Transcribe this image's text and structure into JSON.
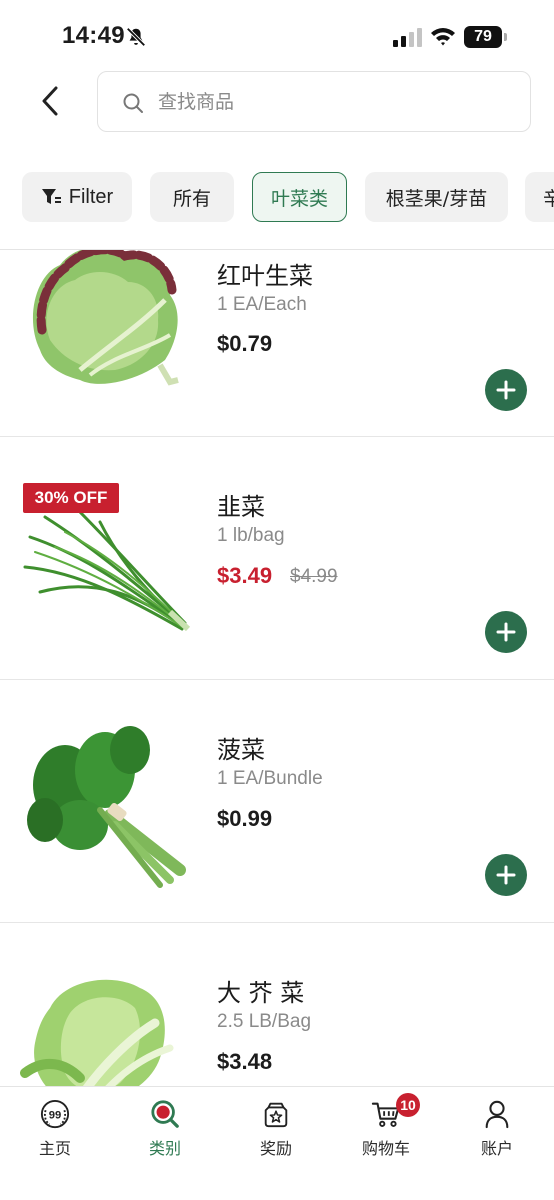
{
  "status_bar": {
    "time": "14:49",
    "battery": "79",
    "icons": [
      "bell-slash-icon",
      "signal-icon",
      "wifi-icon",
      "battery-icon"
    ]
  },
  "header": {
    "back_icon": "chevron-left-icon",
    "search": {
      "placeholder": "查找商品",
      "value": "",
      "icon": "search-icon"
    }
  },
  "chips": {
    "filter": "Filter",
    "all": "所有",
    "leafy": "叶菜类",
    "root": "根茎果/芽苗",
    "more": "辛"
  },
  "active_chip": "叶菜类",
  "products": [
    {
      "name": "红叶生菜",
      "unit": "1 EA/Each",
      "price": "$0.79",
      "image": "red-leaf-lettuce"
    },
    {
      "name": "韭菜",
      "unit": "1 lb/bag",
      "price": "$3.49",
      "old_price": "$4.99",
      "badge": "30% OFF",
      "image": "chives"
    },
    {
      "name": "菠菜",
      "unit": "1 EA/Bundle",
      "price": "$0.99",
      "image": "spinach"
    },
    {
      "name": "大 芥 菜",
      "unit": "2.5 LB/Bag",
      "price": "$3.48",
      "image": "mustard-greens"
    }
  ],
  "bottom_nav": {
    "home": "主页",
    "category": "类别",
    "rewards": "奖励",
    "cart": "购物车",
    "account": "账户",
    "cart_count": "10",
    "home_logo_text": "99",
    "active": "类别"
  },
  "colors": {
    "brand_green": "#2c6e4d",
    "sale_red": "#c8202f",
    "text_gray": "#8a8a8a"
  }
}
